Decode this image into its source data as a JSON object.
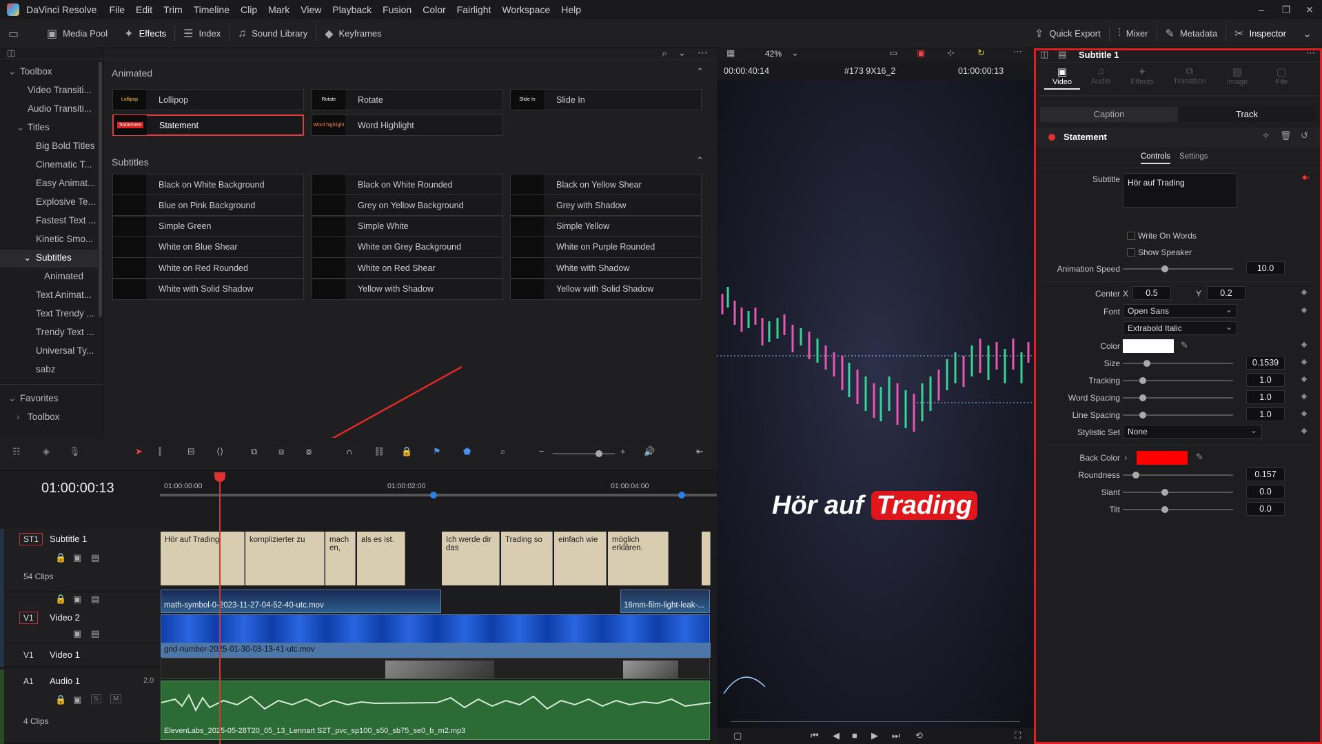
{
  "app": {
    "name": "DaVinci Resolve",
    "menu": [
      "File",
      "Edit",
      "Trim",
      "Timeline",
      "Clip",
      "Mark",
      "View",
      "Playback",
      "Fusion",
      "Color",
      "Fairlight",
      "Workspace",
      "Help"
    ]
  },
  "toolbar": {
    "left": [
      "Media Pool",
      "Effects",
      "Index",
      "Sound Library",
      "Keyframes"
    ],
    "right": [
      "Quick Export",
      "Mixer",
      "Metadata",
      "Inspector"
    ]
  },
  "toolbox": {
    "items": [
      "Toolbox",
      "Video Transiti...",
      "Audio Transiti...",
      "Titles",
      "Big Bold Titles",
      "Cinematic T...",
      "Easy Animat...",
      "Explosive Te...",
      "Fastest Text ...",
      "Kinetic Smo...",
      "Subtitles",
      "Animated",
      "Text Animat...",
      "Text Trendy ...",
      "Trendy Text ...",
      "Universal Ty...",
      "sabz"
    ],
    "favorites": "Favorites",
    "fav_toolbox": "Toolbox"
  },
  "effects": {
    "animated_title": "Animated",
    "animated": [
      {
        "label": "Lollipop",
        "thumb": "Lollipop"
      },
      {
        "label": "Rotate",
        "thumb": "Rotate"
      },
      {
        "label": "Slide In",
        "thumb": "Slide In"
      },
      {
        "label": "Statement",
        "thumb": "Statement"
      },
      {
        "label": "Word Highlight",
        "thumb": "Word highlight"
      }
    ],
    "subtitles_title": "Subtitles",
    "subtitles": [
      "Black on White Background",
      "Black on White Rounded",
      "Black on Yellow Shear",
      "Blue on Pink Background",
      "Grey on Yellow Background",
      "Grey with Shadow",
      "Simple Green",
      "Simple White",
      "Simple Yellow",
      "White on Blue Shear",
      "White on Grey Background",
      "White on Purple Rounded",
      "White on Red Rounded",
      "White on Red Shear",
      "White with Shadow",
      "White with Solid Shadow",
      "Yellow with Shadow",
      "Yellow with Solid Shadow"
    ]
  },
  "viewer": {
    "zoom": "42%",
    "timecode_left": "00:00:40:14",
    "clip_name": "#173 9X16_2",
    "timecode_right": "01:00:00:13",
    "subtitle_plain": "Hör auf",
    "subtitle_highlight": "Trading"
  },
  "inspector": {
    "title": "Subtitle 1",
    "tabs": [
      "Video",
      "Audio",
      "Effects",
      "Transition",
      "Image",
      "File"
    ],
    "subtabs": [
      "Caption",
      "Track"
    ],
    "effect_name": "Statement",
    "ctrl_tabs": [
      "Controls",
      "Settings"
    ],
    "subtitle_label": "Subtitle",
    "subtitle_text": "Hör auf Trading",
    "write_on_words": "Write On Words",
    "show_speaker": "Show Speaker",
    "anim_speed_label": "Animation Speed",
    "anim_speed": "10.0",
    "center_label": "Center",
    "x_label": "X",
    "center_x": "0.5",
    "y_label": "Y",
    "center_y": "0.2",
    "font_label": "Font",
    "font": "Open Sans",
    "font_style": "Extrabold Italic",
    "color_label": "Color",
    "color_value": "#ffffff",
    "size_label": "Size",
    "size": "0.1539",
    "tracking_label": "Tracking",
    "tracking": "1.0",
    "word_spacing_label": "Word Spacing",
    "word_spacing": "1.0",
    "line_spacing_label": "Line Spacing",
    "line_spacing": "1.0",
    "stylistic_label": "Stylistic Set",
    "stylistic": "None",
    "back_color_label": "Back Color",
    "back_color_value": "#ff0000",
    "roundness_label": "Roundness",
    "roundness": "0.157",
    "slant_label": "Slant",
    "slant": "0.0",
    "tilt_label": "Tilt",
    "tilt": "0.0"
  },
  "timeline": {
    "timecode": "01:00:00:13",
    "ruler": [
      "01:00:00:00",
      "01:00:02:00",
      "01:00:04:00"
    ],
    "tracks": [
      {
        "tag": "ST1",
        "name": "Subtitle 1",
        "clips_count": "54 Clips"
      },
      {
        "tag": "V1",
        "name": "Video 2"
      },
      {
        "tag": "V1",
        "name": "Video 1"
      },
      {
        "tag": "A1",
        "name": "Audio 1",
        "vol": "2.0",
        "clips_count": "4 Clips"
      }
    ],
    "subtitle_clips": [
      "Hör auf Trading",
      "komplizierter zu",
      "mach en,",
      "als es ist.",
      "Ich werde dir das",
      "Trading so",
      "einfach wie",
      "möglich erklären."
    ],
    "video3_clip1": "math-symbol-0-2023-11-27-04-52-40-utc.mov",
    "video3_clip2": "16mm-film-light-leak-...",
    "video2_clip": "grid-number-2025-01-30-03-13-41-utc.mov",
    "audio_clip": "ElevenLabs_2025-05-28T20_05_13_Lennart S2T_pvc_sp100_s50_sb75_se0_b_m2.mp3"
  }
}
